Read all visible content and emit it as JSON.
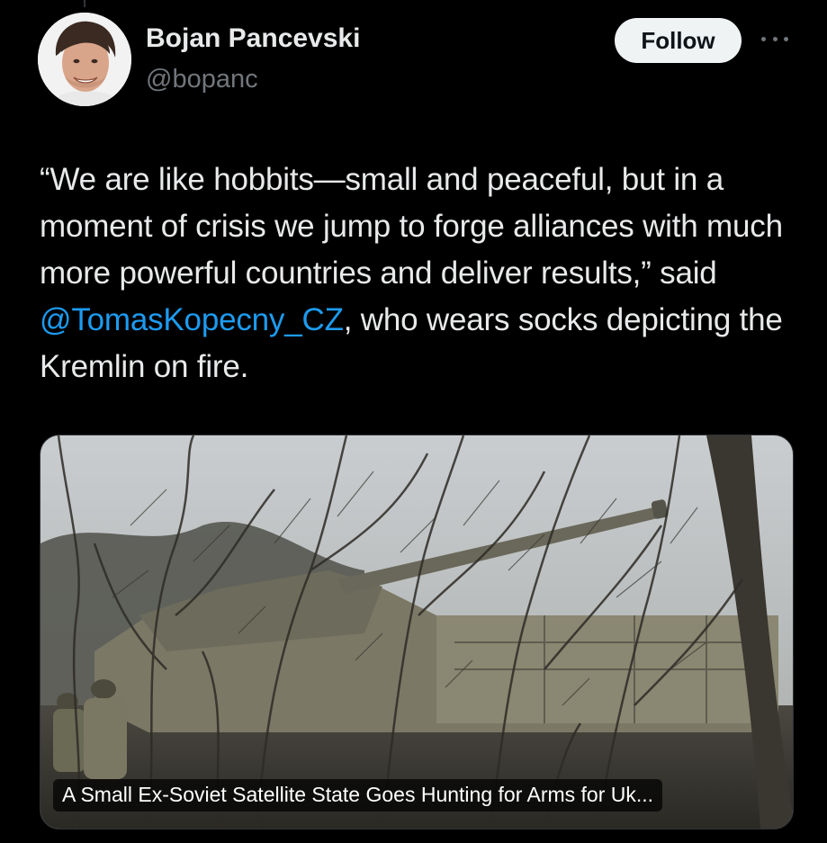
{
  "author": {
    "name": "Bojan Pancevski",
    "handle": "@bopanc"
  },
  "actions": {
    "follow_label": "Follow",
    "more_icon": "more-horizontal-icon"
  },
  "tweet": {
    "text_before": "“We are like hobbits—small and peaceful, but in a moment of crisis we jump to forge alliances with much more powerful countries and deliver results,” said ",
    "mention": "@TomasKopecny_CZ",
    "text_after": ", who wears socks depicting the Kremlin on fire."
  },
  "card": {
    "title": "A Small Ex-Soviet Satellite State Goes Hunting for Arms for Uk..."
  },
  "colors": {
    "background": "#000000",
    "text": "#e7e9ea",
    "secondary": "#71767b",
    "link": "#1d9bf0",
    "follow_bg": "#eff3f4"
  }
}
